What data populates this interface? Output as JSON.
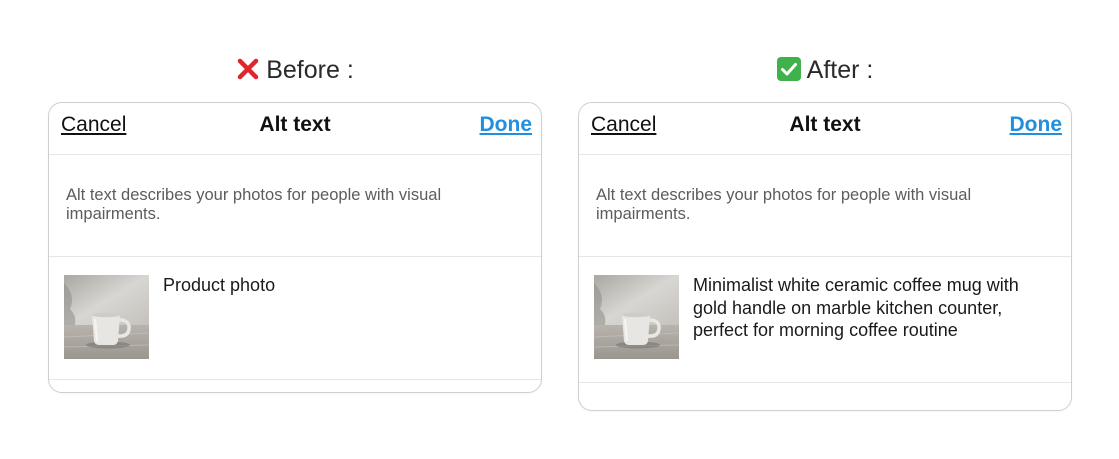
{
  "panels": [
    {
      "heading": "Before :",
      "status": "cross-mark-icon",
      "cancel_label": "Cancel",
      "title": "Alt text",
      "done_label": "Done",
      "description": "Alt text describes your photos for people with visual impairments.",
      "alt_text_value": "Product photo"
    },
    {
      "heading": "After :",
      "status": "check-mark-icon",
      "cancel_label": "Cancel",
      "title": "Alt text",
      "done_label": "Done",
      "description": "Alt text describes your photos for people with visual impairments.",
      "alt_text_value": "Minimalist white ceramic coffee mug with gold handle on marble kitchen counter, perfect for morning coffee routine"
    }
  ],
  "colors": {
    "done_link": "#1f8fe0",
    "cross_mark": "#e0262a",
    "check_mark": "#3fb24b",
    "card_border": "#cfcfcf",
    "description_text": "#5c5c5c"
  }
}
